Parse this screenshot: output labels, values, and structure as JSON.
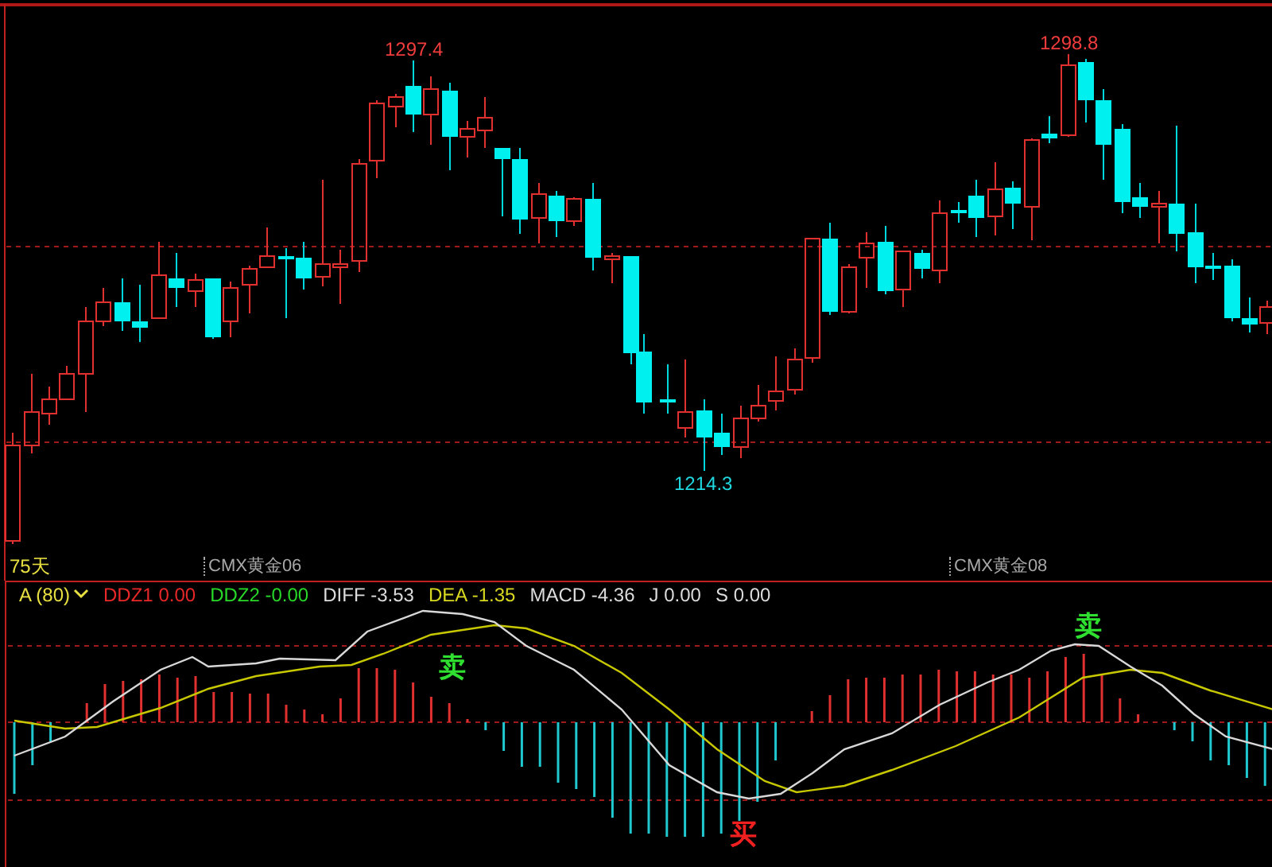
{
  "price_chart": {
    "price_labels": [
      {
        "text": "1297.4",
        "kind": "high"
      },
      {
        "text": "1298.8",
        "kind": "high"
      },
      {
        "text": "1214.3",
        "kind": "low"
      }
    ],
    "period": "75天",
    "contract_marks": [
      {
        "text": "CMX黄金06"
      },
      {
        "text": "CMX黄金08"
      }
    ]
  },
  "indicator": {
    "selector": "A (80)",
    "values": [
      {
        "name": "DDZ1",
        "value": "0.00",
        "color": "#e82828"
      },
      {
        "name": "DDZ2",
        "value": "-0.00",
        "color": "#28d828"
      },
      {
        "name": "DIFF",
        "value": "-3.53",
        "color": "#dcdcdc"
      },
      {
        "name": "DEA",
        "value": "-1.35",
        "color": "#d8d820"
      },
      {
        "name": "MACD",
        "value": "-4.36",
        "color": "#dcdcdc"
      },
      {
        "name": "J",
        "value": "0.00",
        "color": "#dcdcdc"
      },
      {
        "name": "S",
        "value": "0.00",
        "color": "#dcdcdc"
      }
    ],
    "signals": [
      {
        "text": "卖",
        "kind": "sell"
      },
      {
        "text": "买",
        "kind": "buy"
      },
      {
        "text": "卖",
        "kind": "sell"
      }
    ]
  }
}
